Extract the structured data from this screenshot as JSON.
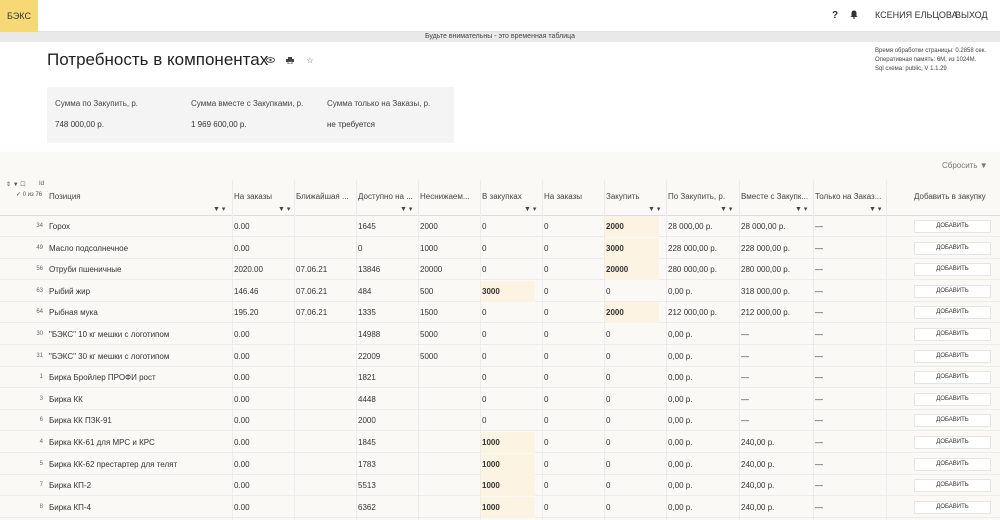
{
  "app": {
    "logo": "БЭКС"
  },
  "header": {
    "help": "?",
    "user": "КСЕНИЯ ЕЛЬЦОВА",
    "logout": "ВЫХОД"
  },
  "warning": "Будьте внимательны - это временная таблица",
  "page": {
    "title": "Потребность в компонентах"
  },
  "sysinfo": [
    "Время обработки страницы: 0.2858 сек.",
    "Оперативная память: 6M, из 1024M.",
    "Sql схема: public, V 1.1.29"
  ],
  "summary": {
    "labels": [
      "Сумма по Закупить, р.",
      "Сумма вместе с Закупками, р.",
      "Сумма только на Заказы, р."
    ],
    "values": [
      "748 000,00 р.",
      "1 969 600,00 р.",
      "не требуется"
    ]
  },
  "table": {
    "reset": "Сбросить",
    "id_label": "Id",
    "count_label": "✓ 0 из 76",
    "headers": [
      "Позиция",
      "На заказы",
      "Ближайшая ...",
      "Доступно на ...",
      "Неснижаем...",
      "В закупках",
      "На заказы",
      "Закупить",
      "По Закупить, р.",
      "Вместе с Закупк...",
      "Только на Заказ...",
      "Добавить в закупку"
    ],
    "add_label": "ДОБАВИТЬ",
    "rows": [
      {
        "id": "34",
        "cells": [
          "Горох",
          "0.00",
          "",
          "1645",
          "2000",
          "0",
          "0",
          "2000",
          "28 000,00 р.",
          "28 000,00 р.",
          "—"
        ]
      },
      {
        "id": "49",
        "cells": [
          "Масло подсолнечное",
          "0.00",
          "",
          "0",
          "1000",
          "0",
          "0",
          "3000",
          "228 000,00 р.",
          "228 000,00 р.",
          "—"
        ]
      },
      {
        "id": "56",
        "cells": [
          "Отруби пшеничные",
          "2020.00",
          "07.06.21",
          "13846",
          "20000",
          "0",
          "0",
          "20000",
          "280 000,00 р.",
          "280 000,00 р.",
          "—"
        ]
      },
      {
        "id": "63",
        "cells": [
          "Рыбий жир",
          "146.46",
          "07.06.21",
          "484",
          "500",
          "3000",
          "0",
          "0",
          "0,00 р.",
          "318 000,00 р.",
          "—"
        ]
      },
      {
        "id": "64",
        "cells": [
          "Рыбная мука",
          "195.20",
          "07.06.21",
          "1335",
          "1500",
          "0",
          "0",
          "2000",
          "212 000,00 р.",
          "212 000,00 р.",
          "—"
        ]
      },
      {
        "id": "30",
        "cells": [
          "\"БЭКС\" 10 кг мешки с логотипом",
          "0.00",
          "",
          "14988",
          "5000",
          "0",
          "0",
          "0",
          "0,00 р.",
          "—",
          "—"
        ]
      },
      {
        "id": "31",
        "cells": [
          "\"БЭКС\" 30 кг мешки с логотипом",
          "0.00",
          "",
          "22009",
          "5000",
          "0",
          "0",
          "0",
          "0,00 р.",
          "—",
          "—"
        ]
      },
      {
        "id": "1",
        "cells": [
          "Бирка Бройлер ПРОФИ рост",
          "0.00",
          "",
          "1821",
          "",
          "0",
          "0",
          "0",
          "0,00 р.",
          "—",
          "—"
        ]
      },
      {
        "id": "3",
        "cells": [
          "Бирка КК",
          "0.00",
          "",
          "4448",
          "",
          "0",
          "0",
          "0",
          "0,00 р.",
          "—",
          "—"
        ]
      },
      {
        "id": "6",
        "cells": [
          "Бирка КК ПЗК-91",
          "0.00",
          "",
          "2000",
          "",
          "0",
          "0",
          "0",
          "0,00 р.",
          "—",
          "—"
        ]
      },
      {
        "id": "4",
        "cells": [
          "Бирка КК-61 для МРС и КРС",
          "0.00",
          "",
          "1845",
          "",
          "1000",
          "0",
          "0",
          "0,00 р.",
          "240,00 р.",
          "—"
        ]
      },
      {
        "id": "5",
        "cells": [
          "Бирка КК-62 престартер для телят",
          "0.00",
          "",
          "1783",
          "",
          "1000",
          "0",
          "0",
          "0,00 р.",
          "240,00 р.",
          "—"
        ]
      },
      {
        "id": "7",
        "cells": [
          "Бирка КП-2",
          "0.00",
          "",
          "5513",
          "",
          "1000",
          "0",
          "0",
          "0,00 р.",
          "240,00 р.",
          "—"
        ]
      },
      {
        "id": "8",
        "cells": [
          "Бирка КП-4",
          "0.00",
          "",
          "6362",
          "",
          "1000",
          "0",
          "0",
          "0,00 р.",
          "240,00 р.",
          "—"
        ]
      }
    ]
  }
}
